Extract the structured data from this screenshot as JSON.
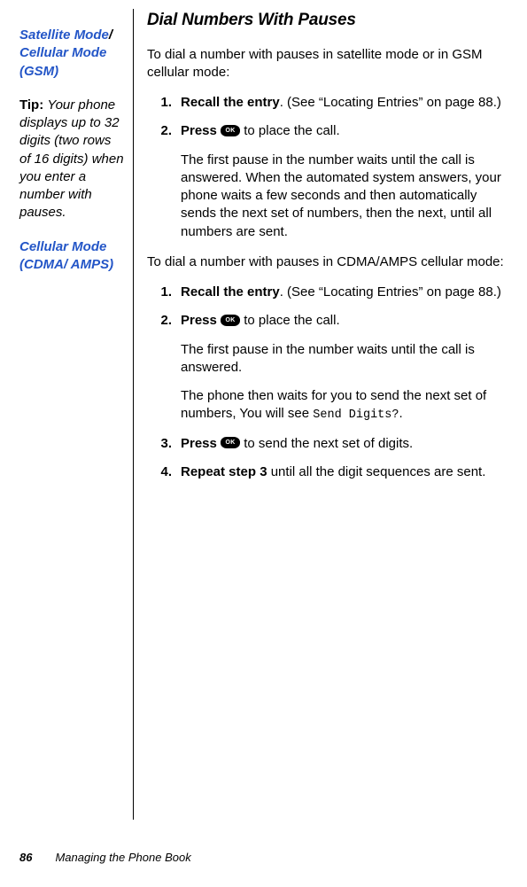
{
  "heading": "Dial Numbers With Pauses",
  "sidebar": {
    "mode1a": "Satellite Mode",
    "mode1sep": "/ ",
    "mode1b": "Cellular Mode (GSM)",
    "tipLabel": "Tip: ",
    "tipText": "Your phone displays up to 32 digits (two rows of 16 digits) when you enter a number with pauses.",
    "mode2": "Cellular Mode (CDMA/ AMPS)"
  },
  "section1": {
    "intro": "To dial a number with pauses in satellite mode or in GSM cellular mode:",
    "step1num": "1.",
    "step1lead": "Recall the entry",
    "step1rest": ". (See “Locating Entries” on page 88.)",
    "step2num": "2.",
    "step2lead": "Press ",
    "step2rest": " to place the call.",
    "step2para": "The first pause in the number waits until the call is answered. When the automated system answers, your phone waits a few seconds and then automatically sends the next set of numbers, then the next, until all numbers are sent."
  },
  "section2": {
    "intro": "To dial a number with pauses in CDMA/AMPS cellular mode:",
    "step1num": "1.",
    "step1lead": "Recall the entry",
    "step1rest": ". (See “Locating Entries” on page 88.)",
    "step2num": "2.",
    "step2lead": "Press ",
    "step2rest": " to place the call.",
    "step2para1": "The first pause in the number waits until the call is answered.",
    "step2para2a": "The phone then waits for you to send the next set of numbers, You will see ",
    "step2para2lcd": "Send Digits?",
    "step2para2b": ".",
    "step3num": "3.",
    "step3lead": "Press ",
    "step3rest": " to send the next set of digits.",
    "step4num": "4.",
    "step4lead": "Repeat step 3",
    "step4rest": " until all the digit sequences are sent."
  },
  "okLabel": "OK",
  "footer": {
    "pageNum": "86",
    "chapter": "Managing the Phone Book"
  }
}
